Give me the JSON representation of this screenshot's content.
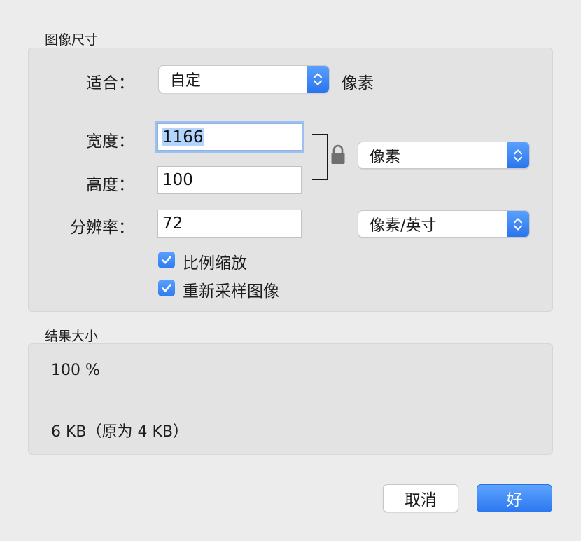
{
  "image_size": {
    "title": "图像尺寸",
    "fit": {
      "label": "适合：",
      "value": "自定",
      "unit": "像素"
    },
    "width": {
      "label": "宽度：",
      "value": "1166"
    },
    "height": {
      "label": "高度：",
      "value": "100"
    },
    "size_unit": "像素",
    "resolution": {
      "label": "分辨率：",
      "value": "72",
      "unit": "像素/英寸"
    },
    "scale_proportionally": {
      "label": "比例缩放",
      "checked": true
    },
    "resample": {
      "label": "重新采样图像",
      "checked": true
    }
  },
  "result_size": {
    "title": "结果大小",
    "percent": "100 %",
    "file_size": "6 KB（原为 4 KB）"
  },
  "buttons": {
    "cancel": "取消",
    "ok": "好"
  },
  "colors": {
    "accent": "#3b82f6",
    "background": "#ececec",
    "group_background": "#e3e3e3"
  }
}
